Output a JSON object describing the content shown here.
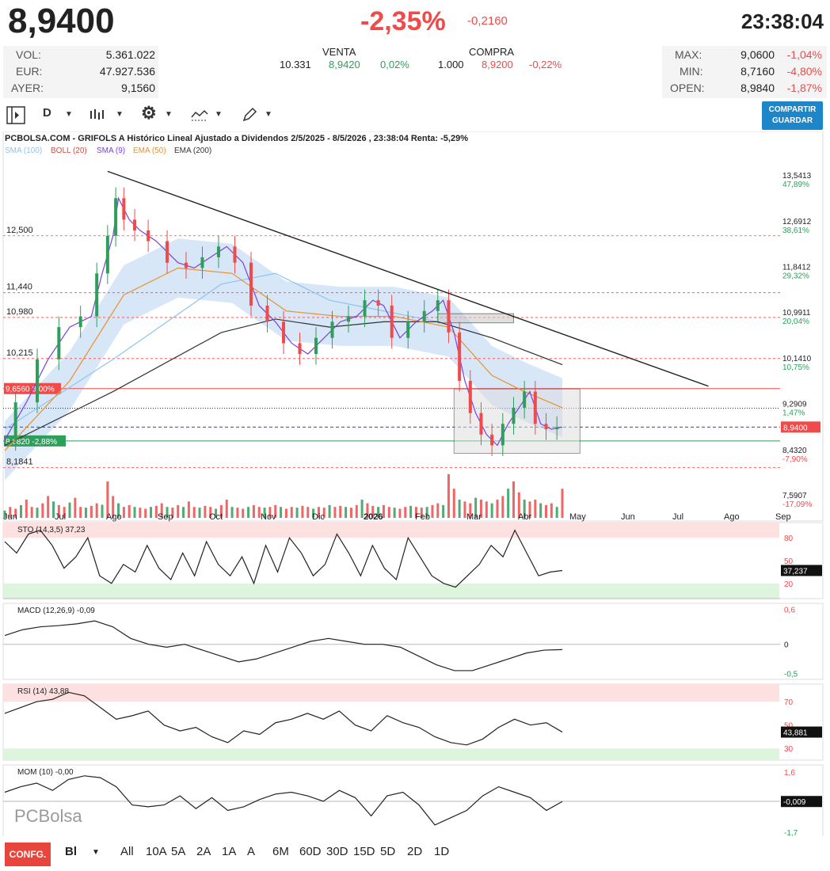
{
  "header": {
    "price": "8,9400",
    "change_pct": "-2,35%",
    "change_abs": "-0,2160",
    "time": "23:38:04"
  },
  "stats_left": [
    {
      "label": "VOL:",
      "value": "5.361.022"
    },
    {
      "label": "EUR:",
      "value": "47.927.536"
    },
    {
      "label": "AYER:",
      "value": "9,1560"
    }
  ],
  "venta": {
    "label": "VENTA",
    "qty": "10.331",
    "price": "8,9420",
    "pct": "0,02%"
  },
  "compra": {
    "label": "COMPRA",
    "qty": "1.000",
    "price": "8,9200",
    "pct": "-0,22%"
  },
  "stats_right": [
    {
      "label": "MAX:",
      "value": "9,0600",
      "pct": "-1,04%"
    },
    {
      "label": "MIN:",
      "value": "8,7160",
      "pct": "-4,80%"
    },
    {
      "label": "OPEN:",
      "value": "8,9840",
      "pct": "-1,87%"
    }
  ],
  "toolbar": {
    "period": "D",
    "share_label": "COMPARTIR",
    "save_label": "GUARDAR"
  },
  "chart_title": "PCBOLSA.COM - GRIFOLS A Histórico Lineal Ajustado a Dividendos 2/5/2025 - 8/5/2026 , 23:38:04 Renta: -5,29%",
  "colors": {
    "up": "#2e9e5b",
    "down": "#f04a4a",
    "sma100": "#8fc3ee",
    "boll": "#e8453c",
    "sma9": "#7b3fe4",
    "ema50": "#e8922c",
    "ema200": "#333333",
    "accent": "#1d86c9"
  },
  "chart_data": {
    "type": "line",
    "legend": [
      {
        "label": "SMA (100)",
        "color": "#8fc3ee"
      },
      {
        "label": "BOLL (20)",
        "color": "#e8453c"
      },
      {
        "label": "SMA (9)",
        "color": "#7b3fe4"
      },
      {
        "label": "EMA (50)",
        "color": "#e8922c"
      },
      {
        "label": "EMA (200)",
        "color": "#333333"
      }
    ],
    "x_labels": [
      "Jun",
      "Jul",
      "Ago",
      "Sep",
      "Oct",
      "Nov",
      "Dic",
      "2026",
      "Feb",
      "Mar",
      "Abr",
      "May",
      "Jun",
      "Jul",
      "Ago",
      "Sep"
    ],
    "ylim": [
      7.25,
      14.0
    ],
    "right_ticks": [
      {
        "v": 13.5413,
        "label": "13,5413",
        "pct": "47,89%"
      },
      {
        "v": 12.6912,
        "label": "12,6912",
        "pct": "38,61%"
      },
      {
        "v": 11.8412,
        "label": "11,8412",
        "pct": "29,32%"
      },
      {
        "v": 10.9911,
        "label": "10,9911",
        "pct": "20,04%"
      },
      {
        "v": 10.141,
        "label": "10,1410",
        "pct": "10,75%"
      },
      {
        "v": 9.2909,
        "label": "9,2909",
        "pct": "1,47%"
      },
      {
        "v": 8.432,
        "label": "8,4320",
        "pct": "-7,90%"
      },
      {
        "v": 7.5907,
        "label": "7,5907",
        "pct": "-17,09%"
      }
    ],
    "left_levels": [
      {
        "v": 12.5,
        "label": "12,500"
      },
      {
        "v": 11.44,
        "label": "11,440"
      },
      {
        "v": 10.98,
        "label": "10,980"
      },
      {
        "v": 10.215,
        "label": "10,215"
      },
      {
        "v": 8.1841,
        "label": "8,1841"
      }
    ],
    "last_price": {
      "v": 8.94,
      "label": "8,9400"
    },
    "resistance": {
      "v": 9.656,
      "label": "9,6560",
      "pct": "8,00%"
    },
    "support": {
      "v": 8.682,
      "label": "8,6820",
      "pct": "-2,88%"
    },
    "close": [
      {
        "x": 0,
        "y": 8.7
      },
      {
        "x": 4,
        "y": 9.4
      },
      {
        "x": 8,
        "y": 10.2
      },
      {
        "x": 12,
        "y": 10.8
      },
      {
        "x": 16,
        "y": 11.0
      },
      {
        "x": 18,
        "y": 11.8
      },
      {
        "x": 20,
        "y": 12.5
      },
      {
        "x": 21,
        "y": 13.2
      },
      {
        "x": 23,
        "y": 12.8
      },
      {
        "x": 25,
        "y": 12.6
      },
      {
        "x": 28,
        "y": 12.4
      },
      {
        "x": 32,
        "y": 12.0
      },
      {
        "x": 35,
        "y": 11.9
      },
      {
        "x": 38,
        "y": 12.1
      },
      {
        "x": 41,
        "y": 12.3
      },
      {
        "x": 44,
        "y": 12.0
      },
      {
        "x": 47,
        "y": 11.2
      },
      {
        "x": 50,
        "y": 10.9
      },
      {
        "x": 53,
        "y": 10.5
      },
      {
        "x": 56,
        "y": 10.3
      },
      {
        "x": 59,
        "y": 10.6
      },
      {
        "x": 62,
        "y": 10.9
      },
      {
        "x": 65,
        "y": 11.0
      },
      {
        "x": 68,
        "y": 11.3
      },
      {
        "x": 70,
        "y": 11.2
      },
      {
        "x": 73,
        "y": 10.6
      },
      {
        "x": 76,
        "y": 10.9
      },
      {
        "x": 79,
        "y": 11.1
      },
      {
        "x": 81,
        "y": 11.3
      },
      {
        "x": 83,
        "y": 10.7
      },
      {
        "x": 85,
        "y": 9.8
      },
      {
        "x": 87,
        "y": 9.2
      },
      {
        "x": 89,
        "y": 8.8
      },
      {
        "x": 91,
        "y": 8.6
      },
      {
        "x": 93,
        "y": 9.0
      },
      {
        "x": 95,
        "y": 9.3
      },
      {
        "x": 97,
        "y": 9.6
      },
      {
        "x": 99,
        "y": 9.0
      },
      {
        "x": 101,
        "y": 8.9
      },
      {
        "x": 103,
        "y": 8.94
      }
    ],
    "sma100": [
      {
        "x": 0,
        "y": 8.9
      },
      {
        "x": 20,
        "y": 10.2
      },
      {
        "x": 40,
        "y": 11.6
      },
      {
        "x": 50,
        "y": 11.8
      },
      {
        "x": 60,
        "y": 11.3
      },
      {
        "x": 70,
        "y": 11.1
      },
      {
        "x": 80,
        "y": 10.9
      },
      {
        "x": 90,
        "y": 10.6
      },
      {
        "x": 103,
        "y": 10.1
      }
    ],
    "ema200": [
      {
        "x": 0,
        "y": 8.6
      },
      {
        "x": 20,
        "y": 9.6
      },
      {
        "x": 40,
        "y": 10.7
      },
      {
        "x": 50,
        "y": 10.95
      },
      {
        "x": 60,
        "y": 10.8
      },
      {
        "x": 70,
        "y": 10.9
      },
      {
        "x": 80,
        "y": 10.9
      },
      {
        "x": 90,
        "y": 10.6
      },
      {
        "x": 103,
        "y": 10.1
      }
    ],
    "ema50": [
      {
        "x": 0,
        "y": 8.5
      },
      {
        "x": 12,
        "y": 9.8
      },
      {
        "x": 22,
        "y": 11.4
      },
      {
        "x": 32,
        "y": 11.9
      },
      {
        "x": 42,
        "y": 11.8
      },
      {
        "x": 52,
        "y": 11.1
      },
      {
        "x": 62,
        "y": 11.0
      },
      {
        "x": 72,
        "y": 11.0
      },
      {
        "x": 82,
        "y": 10.8
      },
      {
        "x": 90,
        "y": 9.9
      },
      {
        "x": 96,
        "y": 9.6
      },
      {
        "x": 103,
        "y": 9.3
      }
    ],
    "trendline": [
      {
        "x": 19,
        "y": 13.7
      },
      {
        "x": 130,
        "y": 9.7
      }
    ],
    "volume": [
      0.2,
      0.3,
      0.25,
      0.35,
      0.5,
      0.3,
      0.28,
      0.4,
      0.6,
      0.45,
      0.35,
      0.3,
      0.42,
      0.55,
      0.3,
      0.28,
      0.33,
      0.4,
      0.36,
      1.0,
      0.6,
      0.4,
      0.3,
      0.35,
      0.3,
      0.28,
      0.25,
      0.3,
      0.33,
      0.4,
      0.3,
      0.28,
      0.35,
      0.3,
      0.45,
      0.3,
      0.28,
      0.33,
      0.3,
      0.25,
      0.35,
      0.5,
      0.3,
      0.28,
      0.25,
      0.3,
      0.35,
      0.3,
      0.28,
      0.3,
      0.35,
      0.3,
      0.25,
      0.3,
      0.28,
      0.33,
      0.3,
      0.25,
      0.3,
      0.28,
      0.35,
      0.3,
      0.33,
      0.3,
      0.28,
      0.35,
      0.5,
      0.4,
      0.33,
      0.3,
      0.35,
      0.3,
      0.28,
      0.25,
      0.3,
      0.33,
      0.3,
      0.28,
      0.3,
      0.35,
      0.4,
      0.35,
      1.2,
      0.8,
      0.5,
      0.45,
      0.4,
      0.55,
      0.5,
      0.45,
      0.4,
      0.5,
      0.6,
      0.8,
      1.0,
      0.7,
      0.5,
      0.45,
      0.5,
      0.4,
      0.35,
      0.4,
      0.3,
      0.8
    ],
    "sto": {
      "label": "STO (14,3,5)",
      "value": "37,23",
      "last": "37,237",
      "levels": [
        {
          "v": 80,
          "label": "80"
        },
        {
          "v": 50,
          "label": "50"
        },
        {
          "v": 20,
          "label": "20"
        }
      ],
      "values": [
        75,
        60,
        85,
        90,
        70,
        40,
        55,
        80,
        30,
        20,
        45,
        35,
        70,
        40,
        25,
        60,
        30,
        75,
        45,
        30,
        55,
        20,
        70,
        35,
        80,
        60,
        30,
        45,
        85,
        60,
        30,
        70,
        40,
        25,
        80,
        55,
        30,
        20,
        15,
        30,
        45,
        70,
        55,
        90,
        60,
        30,
        35,
        37
      ]
    },
    "macd": {
      "label": "MACD (12,26,9)",
      "value": "-0,09",
      "levels": [
        {
          "v": 0.6,
          "label": "0,6"
        },
        {
          "v": 0,
          "label": "0"
        },
        {
          "v": -0.5,
          "label": "-0,5"
        }
      ],
      "values": [
        0.15,
        0.25,
        0.3,
        0.32,
        0.35,
        0.4,
        0.3,
        0.1,
        0.0,
        -0.05,
        0.0,
        -0.1,
        -0.2,
        -0.3,
        -0.25,
        -0.15,
        -0.05,
        0.05,
        0.1,
        0.05,
        0.0,
        0.0,
        -0.05,
        -0.2,
        -0.35,
        -0.45,
        -0.45,
        -0.35,
        -0.25,
        -0.15,
        -0.1,
        -0.09
      ]
    },
    "rsi": {
      "label": "RSI (14)",
      "value": "43,88",
      "last": "43,881",
      "levels": [
        {
          "v": 70,
          "label": "70"
        },
        {
          "v": 50,
          "label": "50"
        },
        {
          "v": 30,
          "label": "30"
        }
      ],
      "values": [
        60,
        65,
        70,
        72,
        78,
        75,
        65,
        55,
        58,
        62,
        50,
        45,
        48,
        40,
        35,
        45,
        42,
        52,
        55,
        60,
        55,
        62,
        50,
        45,
        58,
        52,
        48,
        40,
        35,
        33,
        38,
        48,
        55,
        50,
        52,
        44
      ]
    },
    "mom": {
      "label": "MOM (10)",
      "value": "-0,00",
      "last": "-0,009",
      "levels": [
        {
          "v": 1.6,
          "label": "1,6"
        },
        {
          "v": 0,
          "label": ""
        },
        {
          "v": -1.7,
          "label": "-1,7"
        }
      ],
      "values": [
        0.5,
        0.8,
        1.0,
        0.6,
        1.2,
        1.4,
        1.3,
        0.8,
        -0.2,
        -0.3,
        -0.2,
        0.3,
        -0.4,
        0.2,
        -0.5,
        -0.3,
        0.1,
        0.4,
        0.5,
        0.3,
        0.0,
        0.6,
        0.2,
        -0.8,
        0.3,
        0.5,
        -0.2,
        -1.3,
        -0.9,
        -0.5,
        0.3,
        0.8,
        0.5,
        0.2,
        -0.5,
        -0.01
      ]
    }
  },
  "watermark": "PCBolsa",
  "bottom": {
    "config": "CONFG.",
    "bl": "Bl",
    "ranges": [
      "All",
      "10A",
      "5A",
      "2A",
      "1A",
      "A",
      "6M",
      "60D",
      "30D",
      "15D",
      "5D",
      "2D",
      "1D"
    ]
  }
}
